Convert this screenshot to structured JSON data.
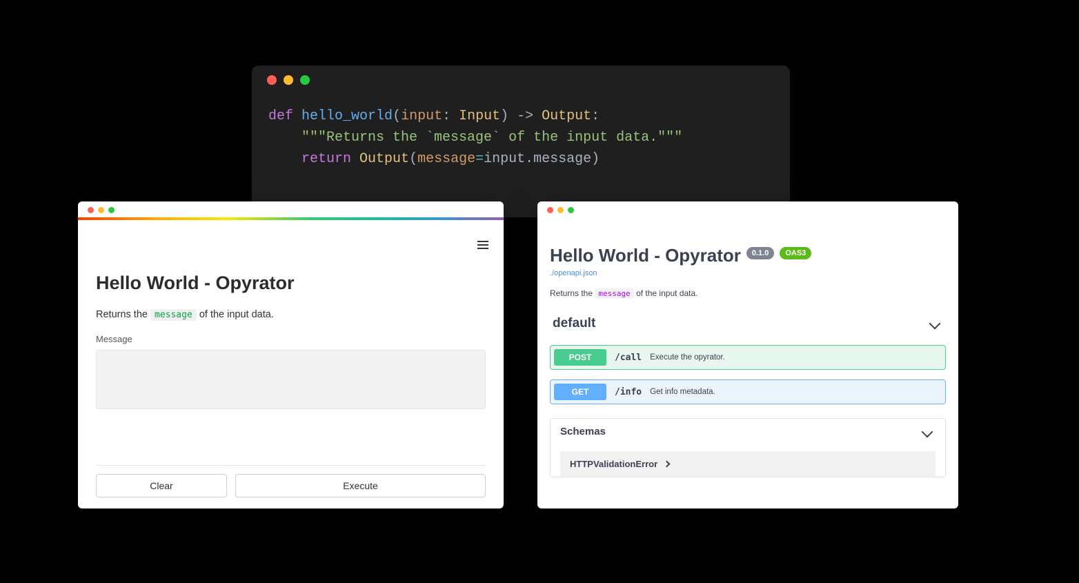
{
  "code": {
    "line1": {
      "def": "def",
      "fn": "hello_world",
      "open": "(",
      "param": "input",
      "colon1": ": ",
      "type_in": "Input",
      "close": ")",
      "arrow": " -> ",
      "type_out": "Output",
      "colon2": ":"
    },
    "line2": "\"\"\"Returns the `message` of the input data.\"\"\"",
    "line3": {
      "ret": "return",
      "cls": "Output",
      "open": "(",
      "kw": "message",
      "eq": "=",
      "inp": "input",
      "dot": ".",
      "attr": "message",
      "close": ")"
    }
  },
  "form": {
    "title": "Hello World - Opyrator",
    "desc_prefix": "Returns the ",
    "desc_code": "message",
    "desc_suffix": " of the input data.",
    "field_label": "Message",
    "clear_label": "Clear",
    "execute_label": "Execute"
  },
  "swagger": {
    "title": "Hello World - Opyrator",
    "version": "0.1.0",
    "oas": "OAS3",
    "spec_link": "./openapi.json",
    "desc_prefix": "Returns the ",
    "desc_code": "message",
    "desc_suffix": " of the input data.",
    "tag": "default",
    "endpoints": [
      {
        "method": "POST",
        "path": "/call",
        "summary": "Execute the opyrator."
      },
      {
        "method": "GET",
        "path": "/info",
        "summary": "Get info metadata."
      }
    ],
    "schemas_label": "Schemas",
    "schema_items": [
      "HTTPValidationError"
    ]
  }
}
